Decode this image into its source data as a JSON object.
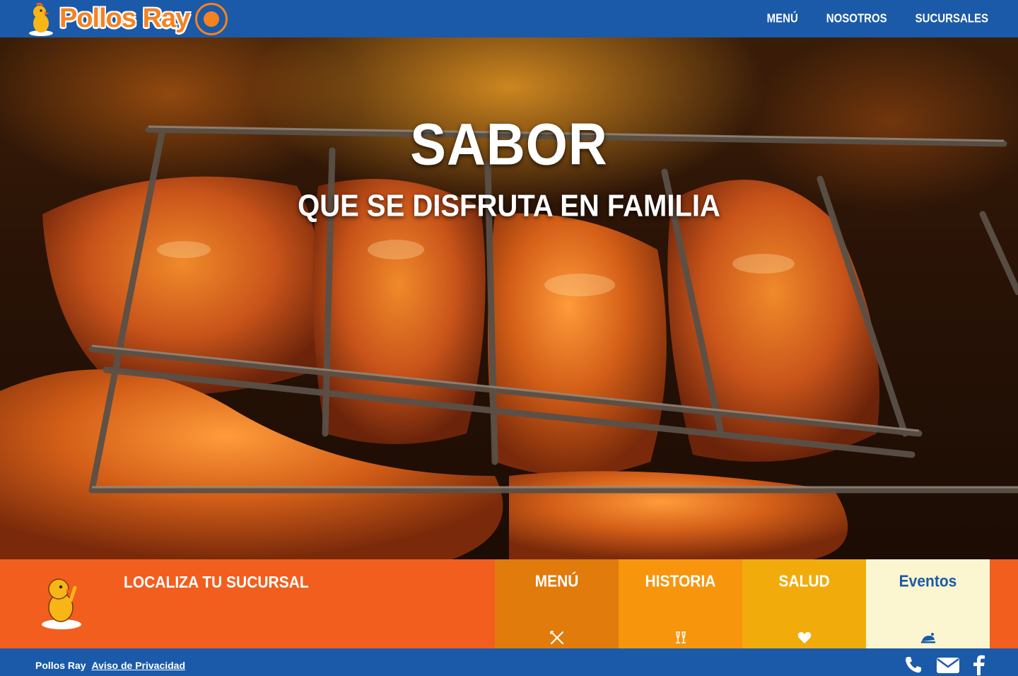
{
  "header": {
    "brand": "Pollos Ray",
    "nav": [
      {
        "label": "MENÚ"
      },
      {
        "label": "NOSOTROS"
      },
      {
        "label": "SUCURSALES"
      }
    ]
  },
  "hero": {
    "title": "SABOR",
    "subtitle": "QUE SE DISFRUTA EN FAMILIA"
  },
  "tiles": {
    "locate": {
      "label": "LOCALIZA TU SUCURSAL",
      "icon": "chicken-mascot-icon"
    },
    "menu": {
      "label": "MENÚ",
      "icon": "fork-knife-icon",
      "color": "#e07b0c"
    },
    "historia": {
      "label": "HISTORIA",
      "icon": "champagne-glasses-icon",
      "color": "#f7950d"
    },
    "salud": {
      "label": "SALUD",
      "icon": "heart-icon",
      "color": "#f1ac0c"
    },
    "eventos": {
      "label": "Eventos",
      "icon": "roast-chicken-icon",
      "color": "#fbf6cf"
    }
  },
  "footer": {
    "brand": "Pollos Ray",
    "privacy_link": "Aviso de Privacidad",
    "icons": [
      "phone-icon",
      "envelope-icon",
      "facebook-icon"
    ]
  },
  "colors": {
    "brand_blue": "#1b5aa8",
    "brand_orange": "#f25e1e",
    "logo_orange": "#f58220"
  }
}
